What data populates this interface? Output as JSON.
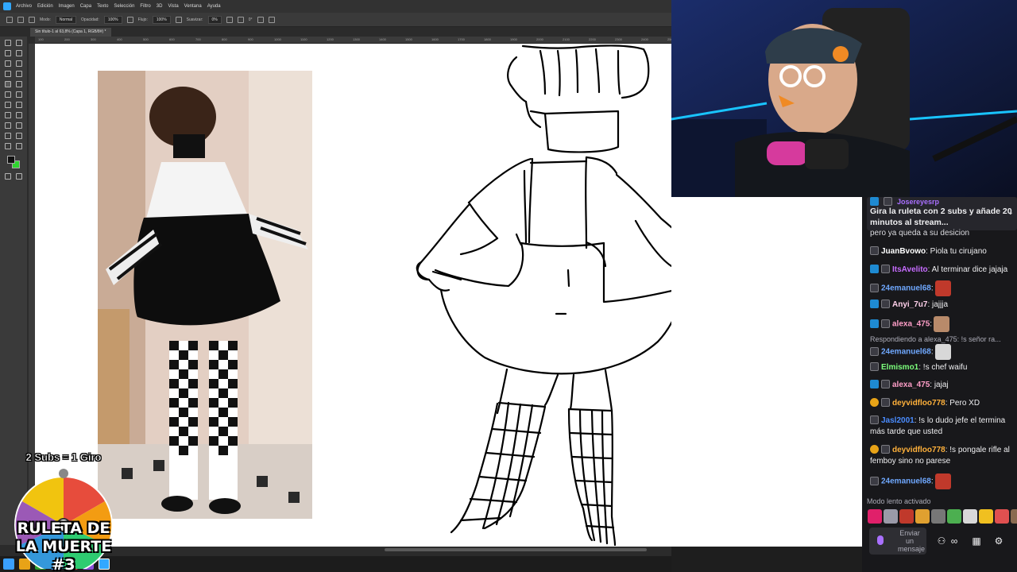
{
  "app": {
    "menu": [
      "Archivo",
      "Edición",
      "Imagen",
      "Capa",
      "Texto",
      "Selección",
      "Filtro",
      "3D",
      "Vista",
      "Ventana",
      "Ayuda"
    ],
    "options": {
      "mode_label": "Modo:",
      "mode_value": "Normal",
      "opacity_label": "Opacidad:",
      "opacity_value": "100%",
      "flow_label": "Flujo:",
      "flow_value": "100%",
      "smoothing_label": "Suavizar:",
      "smoothing_value": "0%",
      "angle_value": "0°"
    },
    "document_tab": "Sin título-1 al 63,8% (Capa 1, RGB/8#) *",
    "ruler_ticks": [
      "100",
      "200",
      "300",
      "400",
      "500",
      "600",
      "700",
      "800",
      "900",
      "1000",
      "1100",
      "1200",
      "1300",
      "1400",
      "1500",
      "1600",
      "1700",
      "1800",
      "1900",
      "2000",
      "2100",
      "2200",
      "2300",
      "2400",
      "2500"
    ]
  },
  "colors": {
    "foreground": "#111111",
    "background": "#2fd42f",
    "twitch_purple": "#a970ff"
  },
  "chat": {
    "pinned": {
      "user": "Josereyesrp",
      "text": "Gira la ruleta con 2 subs y añade 20 minutos al stream..."
    },
    "partial_line": "pero ya queda a su desicion",
    "messages": [
      {
        "user": "JuanBvowo",
        "color": "#ffffff",
        "badge": "sub",
        "text": ": Piola tu cirujano"
      },
      {
        "user": "ItsAvelito",
        "color": "#c76cff",
        "badge": "prime",
        "text": ": Al terminar dice jajaja"
      },
      {
        "user": "24emanuel68",
        "color": "#6fa8ff",
        "badge": "sub",
        "text": ":"
      },
      {
        "user": "Anyi_7u7",
        "color": "#ffd0ea",
        "badge": "prime",
        "text": ": jajjja"
      },
      {
        "user": "alexa_475",
        "color": "#ff9ec8",
        "badge": "prime",
        "text": ":"
      },
      {
        "user": "24emanuel68",
        "color": "#6fa8ff",
        "badge": "sub",
        "text": ":"
      },
      {
        "user": "Elmismo1",
        "color": "#7cff7c",
        "badge": "sub",
        "text": ": !s chef waifu"
      },
      {
        "user": "alexa_475",
        "color": "#ff9ec8",
        "badge": "prime",
        "text": ": jajaj"
      },
      {
        "user": "deyvidfloo778",
        "color": "#ffb13b",
        "badge": "gold",
        "text": ": Pero XD"
      },
      {
        "user": "Jasl2001",
        "color": "#4a8cff",
        "badge": "sub",
        "text": ": !s lo dudo jefe el termina más tarde que usted"
      },
      {
        "user": "deyvidfloo778",
        "color": "#ffb13b",
        "badge": "gold",
        "text": ": !s pongale rifle al femboy sino no parese"
      },
      {
        "user": "24emanuel68",
        "color": "#6fa8ff",
        "badge": "sub",
        "text": ":"
      }
    ],
    "reply_hint": "Respondiendo a alexa_475: !s señor ra...",
    "slow_mode": "Modo lento activado",
    "input_placeholder": "Enviar un mensaje"
  },
  "overlay": {
    "rule": "2 Subs = 1 Giro",
    "title": "RULETA DE LA MUERTE #3"
  }
}
